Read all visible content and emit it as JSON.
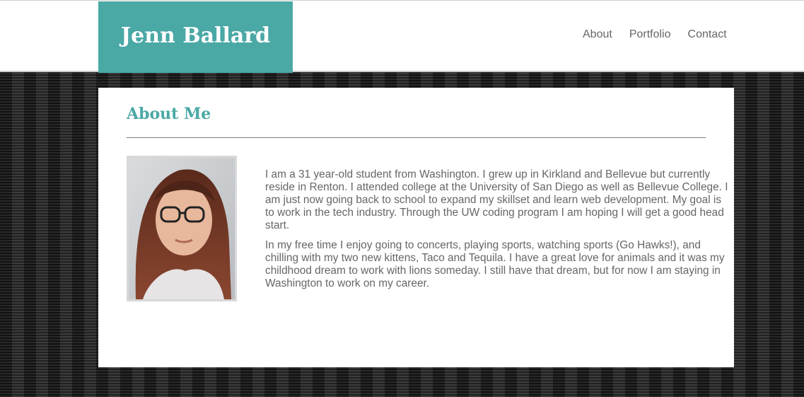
{
  "header": {
    "brand": "Jenn Ballard",
    "nav": [
      "About",
      "Portfolio",
      "Contact"
    ]
  },
  "about": {
    "title": "About Me",
    "photo_alt": "profile-photo",
    "paragraphs": [
      "I am a 31 year-old student from Washington. I grew up in Kirkland and Bellevue but currently reside in Renton. I attended college at the University of San Diego as well as Bellevue College. I am just now going back to school to expand my skillset and learn web development. My goal is to work in the tech industry. Through the UW coding program I am hoping I will get a good head start.",
      "In my free time I enjoy going to concerts, playing sports, watching sports (Go Hawks!), and chilling with my two new kittens, Taco and Tequila. I have a great love for animals and it was my childhood dream to work with lions someday. I still have that dream, but for now I am staying in Washington to work on my career."
    ]
  },
  "colors": {
    "accent": "#4aa8a5",
    "text": "#666666",
    "background": "#2a2a2a"
  }
}
